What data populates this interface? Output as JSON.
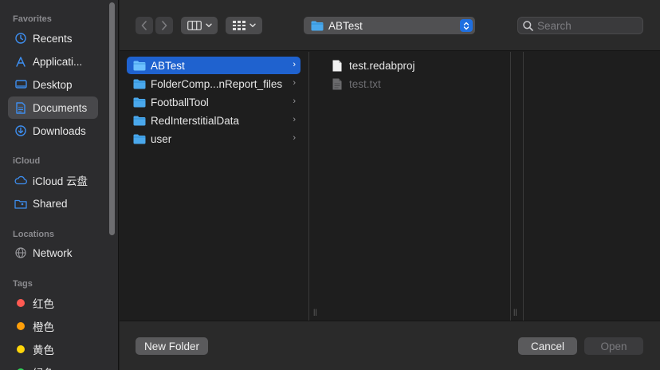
{
  "sidebar": {
    "sections": {
      "favorites": "Favorites",
      "icloud": "iCloud",
      "locations": "Locations",
      "tags": "Tags"
    },
    "favorites": [
      {
        "label": "Recents",
        "icon": "clock-icon"
      },
      {
        "label": "Applicati...",
        "icon": "applications-icon"
      },
      {
        "label": "Desktop",
        "icon": "desktop-icon"
      },
      {
        "label": "Documents",
        "icon": "document-icon",
        "selected": true
      },
      {
        "label": "Downloads",
        "icon": "download-icon"
      }
    ],
    "icloud": [
      {
        "label": "iCloud 云盘",
        "icon": "cloud-icon"
      },
      {
        "label": "Shared",
        "icon": "shared-folder-icon"
      }
    ],
    "locations": [
      {
        "label": "Network",
        "icon": "globe-icon"
      }
    ],
    "tags": [
      {
        "label": "红色",
        "color": "#ff5a52"
      },
      {
        "label": "橙色",
        "color": "#ff9f0a"
      },
      {
        "label": "黄色",
        "color": "#ffd60a"
      },
      {
        "label": "绿色",
        "color": "#30d158"
      }
    ]
  },
  "toolbar": {
    "back_icon": "chevron-left-icon",
    "forward_icon": "chevron-right-icon",
    "view_icon": "column-view-icon",
    "group_icon": "grid-group-icon",
    "path": "ABTest",
    "search_placeholder": "Search"
  },
  "columns": [
    {
      "items": [
        {
          "name": "ABTest",
          "selected": true,
          "has_children": true
        },
        {
          "name": "FolderComp...nReport_files",
          "has_children": true
        },
        {
          "name": "FootballTool",
          "has_children": true
        },
        {
          "name": "RedInterstitialData",
          "has_children": true
        },
        {
          "name": "user",
          "has_children": true
        }
      ]
    },
    {
      "items": [
        {
          "name": "test.redabproj",
          "enabled": true
        },
        {
          "name": "test.txt",
          "enabled": false
        }
      ]
    }
  ],
  "buttons": {
    "new_folder": "New Folder",
    "cancel": "Cancel",
    "open": "Open"
  },
  "colors": {
    "accent": "#1f62cf",
    "folder": "#4aa8ec",
    "sidebar_bg": "#2c2c2e"
  }
}
